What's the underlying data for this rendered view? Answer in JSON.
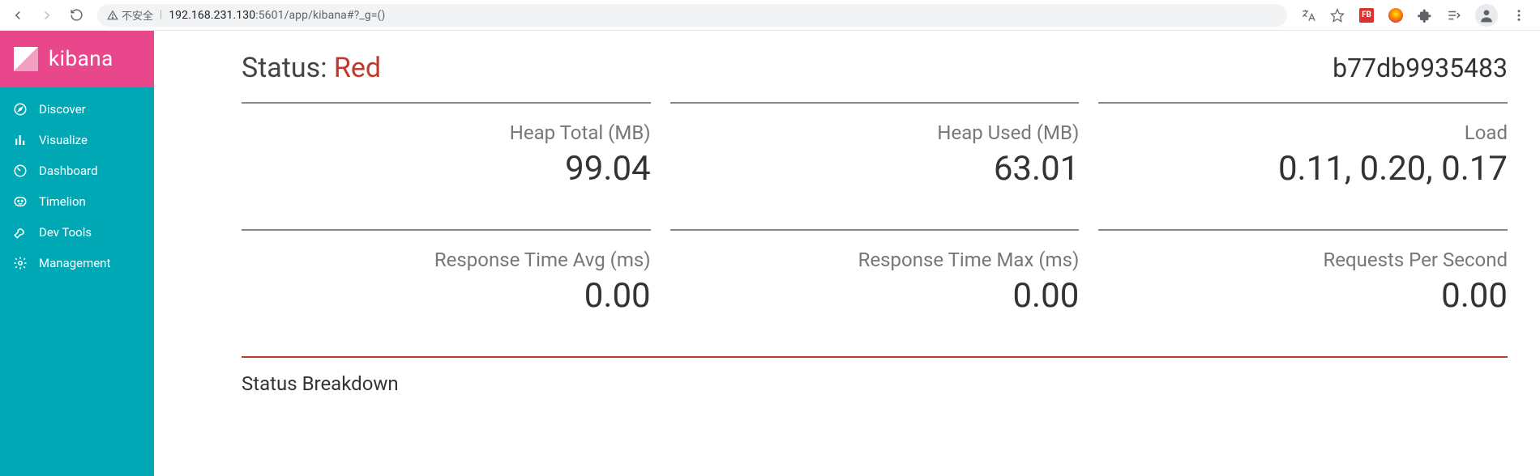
{
  "browser": {
    "warn_label": "不安全",
    "url_host": "192.168.231.130",
    "url_port_path": ":5601/app/kibana#?_g=()"
  },
  "brand": {
    "name": "kibana"
  },
  "sidebar": {
    "items": [
      {
        "icon": "compass",
        "label": "Discover"
      },
      {
        "icon": "barchart",
        "label": "Visualize"
      },
      {
        "icon": "gauge",
        "label": "Dashboard"
      },
      {
        "icon": "face",
        "label": "Timelion"
      },
      {
        "icon": "wrench",
        "label": "Dev Tools"
      },
      {
        "icon": "gear",
        "label": "Management"
      }
    ]
  },
  "status": {
    "prefix": "Status: ",
    "value": "Red",
    "node_id": "b77db9935483"
  },
  "metrics": {
    "row1": [
      {
        "label": "Heap Total (MB)",
        "value": "99.04"
      },
      {
        "label": "Heap Used (MB)",
        "value": "63.01"
      },
      {
        "label": "Load",
        "value": "0.11, 0.20, 0.17"
      }
    ],
    "row2": [
      {
        "label": "Response Time Avg (ms)",
        "value": "0.00"
      },
      {
        "label": "Response Time Max (ms)",
        "value": "0.00"
      },
      {
        "label": "Requests Per Second",
        "value": "0.00"
      }
    ]
  },
  "breakdown": {
    "title": "Status Breakdown"
  }
}
